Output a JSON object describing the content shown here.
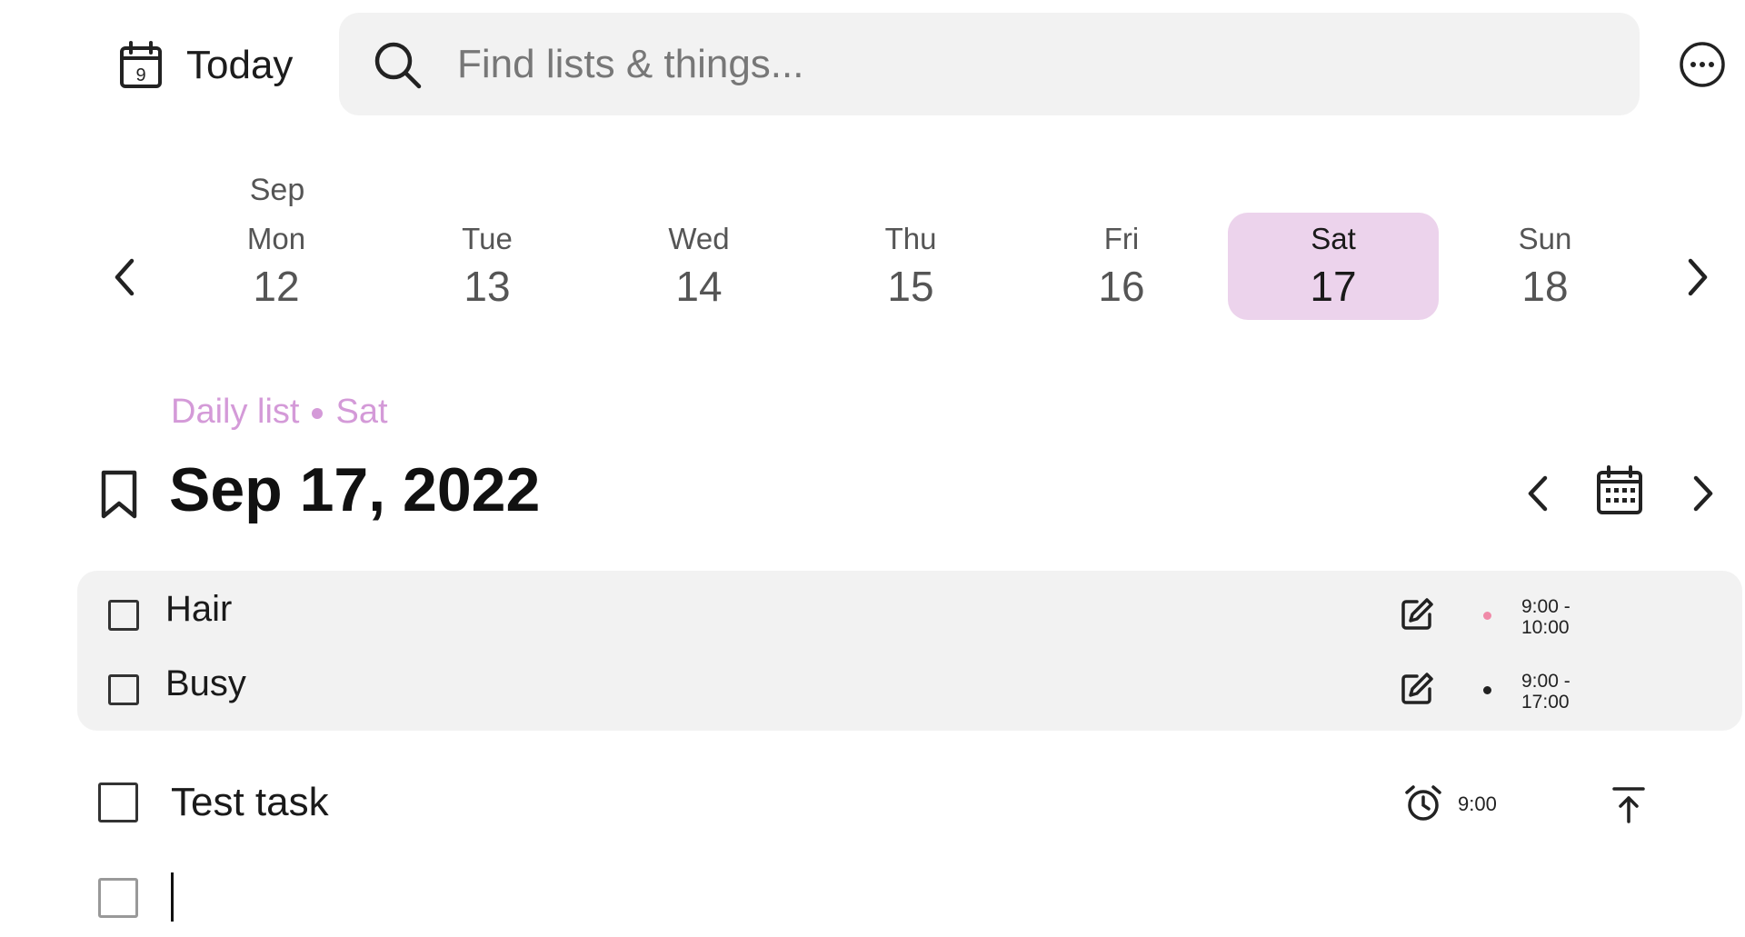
{
  "header": {
    "today_label": "Today",
    "calendar_day": "9",
    "search_placeholder": "Find lists & things..."
  },
  "week": {
    "month": "Sep",
    "days": [
      {
        "name": "Mon",
        "num": "12"
      },
      {
        "name": "Tue",
        "num": "13"
      },
      {
        "name": "Wed",
        "num": "14"
      },
      {
        "name": "Thu",
        "num": "15"
      },
      {
        "name": "Fri",
        "num": "16"
      },
      {
        "name": "Sat",
        "num": "17",
        "selected": true
      },
      {
        "name": "Sun",
        "num": "18"
      }
    ]
  },
  "list": {
    "type_label": "Daily list",
    "day_label": "Sat",
    "title": "Sep 17, 2022"
  },
  "events": [
    {
      "title": "Hair",
      "time_start": "9:00 -",
      "time_end": "10:00",
      "dot_color": "#f08aa8"
    },
    {
      "title": "Busy",
      "time_start": "9:00 -",
      "time_end": "17:00",
      "dot_color": "#222222"
    }
  ],
  "tasks": [
    {
      "title": "Test task",
      "reminder_time": "9:00"
    }
  ],
  "new_task": {
    "value": ""
  },
  "colors": {
    "accent": "#d49ad8",
    "selected_day_bg": "#ecd3ec",
    "panel_bg": "#f2f2f2"
  }
}
